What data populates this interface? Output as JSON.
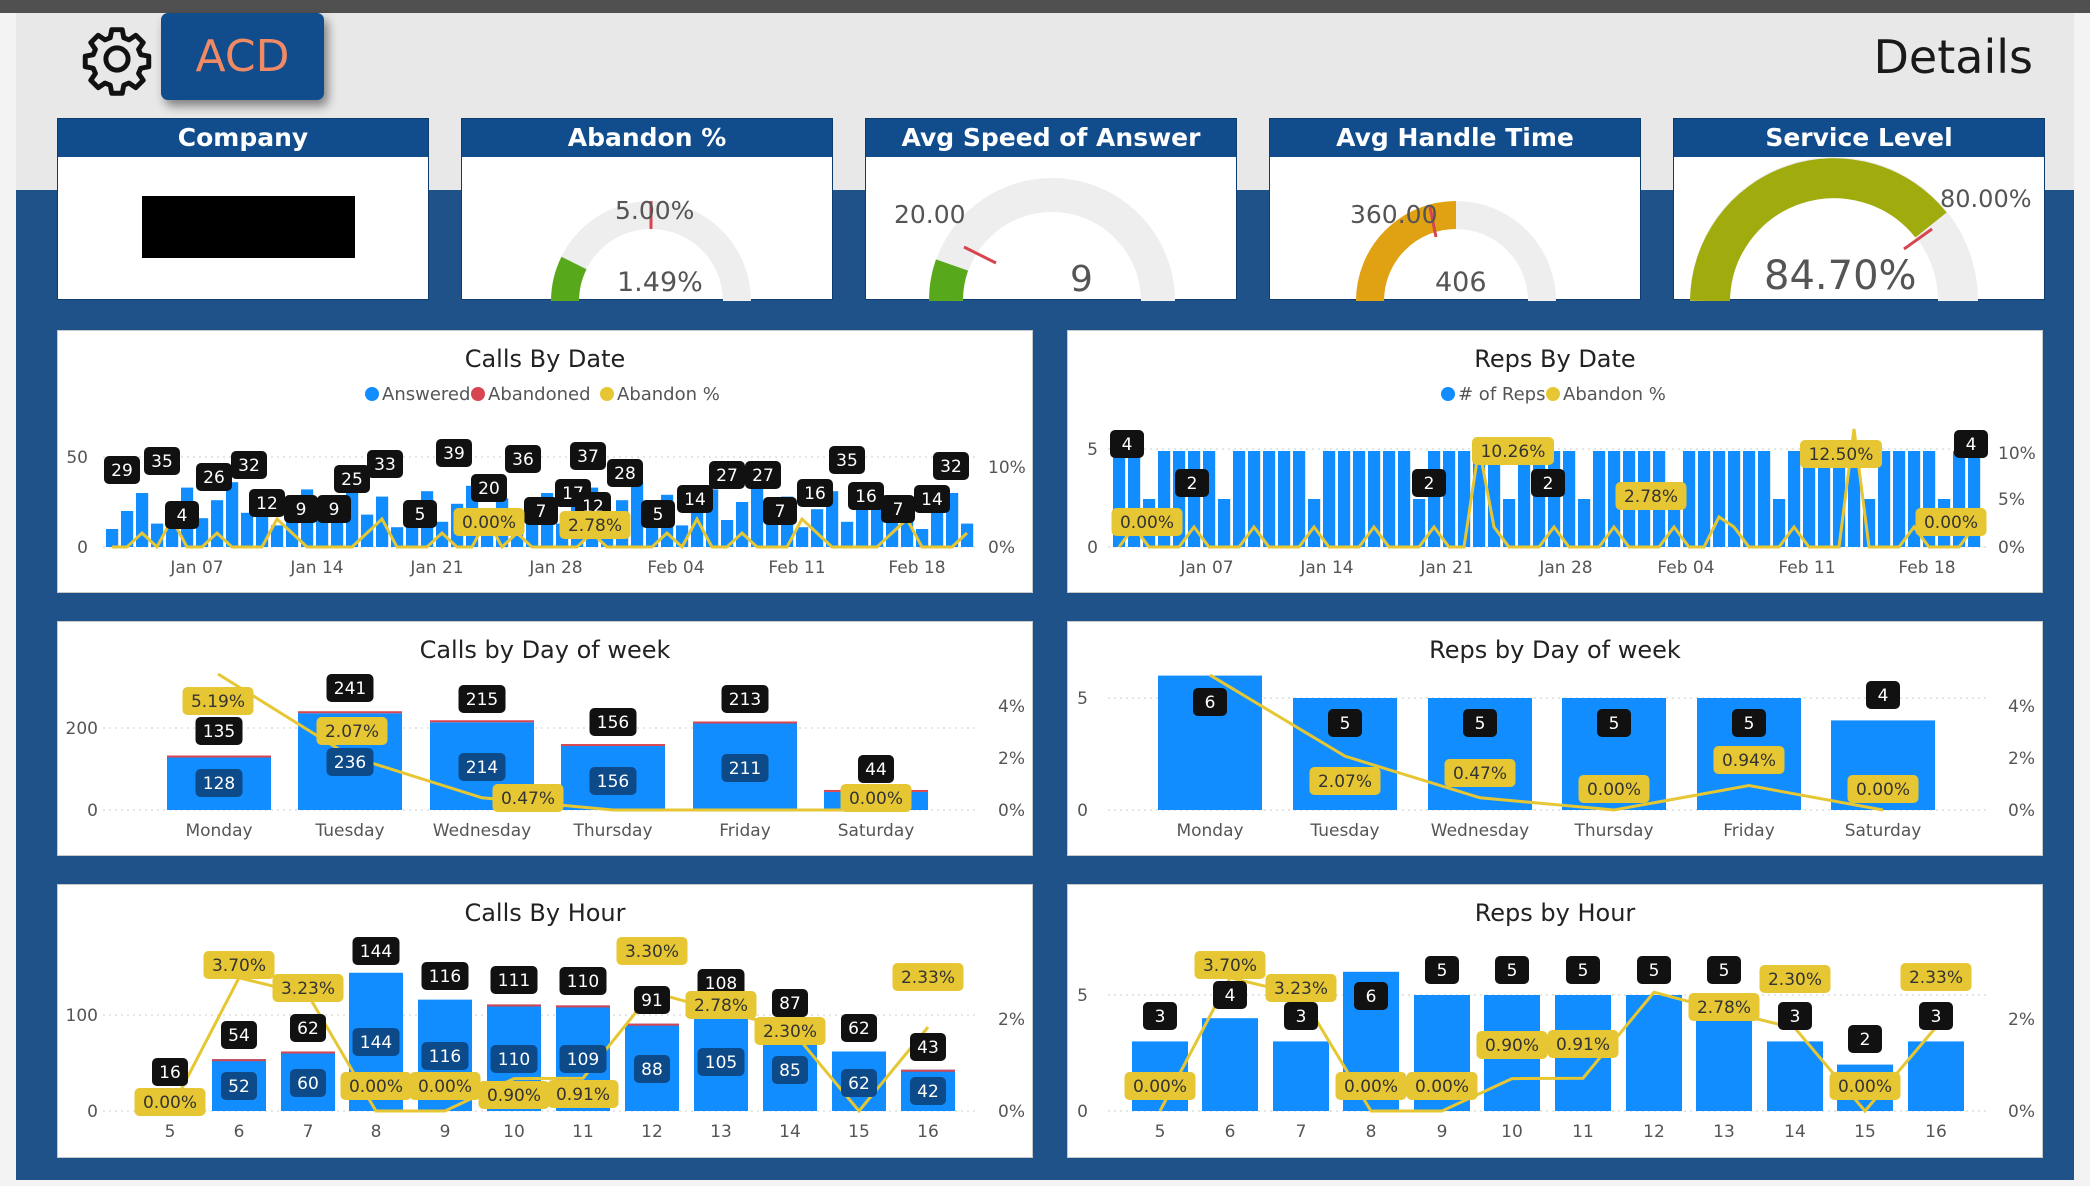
{
  "header": {
    "app_button": "ACD",
    "page_title": "Details",
    "settings_icon": "gear-icon"
  },
  "colors": {
    "navy": "#114c8c",
    "blue_bar": "#118dff",
    "red": "#d64550",
    "gold": "#e6c733",
    "gauge_green": "#57a81a",
    "gauge_orange": "#e0a112",
    "gauge_olive": "#a0ab0d",
    "label_dark": "#111111"
  },
  "kpis": {
    "company": {
      "title": "Company"
    },
    "abandon": {
      "title": "Abandon %",
      "target": "5.00%",
      "value": "1.49%",
      "fraction": 0.149
    },
    "asa": {
      "title": "Avg Speed of Answer",
      "target": "20.00",
      "value": "9",
      "fraction": 0.15
    },
    "aht": {
      "title": "Avg Handle Time",
      "target": "360.00",
      "value": "406",
      "fraction": 0.5
    },
    "service": {
      "title": "Service Level",
      "target": "80.00%",
      "value": "84.70%",
      "fraction": 0.8
    }
  },
  "charts": {
    "calls_by_date": {
      "title": "Calls By Date",
      "legend": [
        "Answered",
        "Abandoned",
        "Abandon %"
      ],
      "y_ticks": [
        "0",
        "50"
      ],
      "y2_ticks": [
        "0%",
        "10%"
      ],
      "x_ticks": [
        "Jan 07",
        "Jan 14",
        "Jan 21",
        "Jan 28",
        "Feb 04",
        "Feb 11",
        "Feb 18"
      ],
      "call_labels": [
        "29",
        "35",
        "4",
        "26",
        "32",
        "12",
        "9",
        "9",
        "25",
        "33",
        "5",
        "39",
        "20",
        "36",
        "7",
        "17",
        "12",
        "37",
        "28",
        "5",
        "14",
        "27",
        "27",
        "7",
        "16",
        "35",
        "16",
        "7",
        "14",
        "32"
      ],
      "pct_labels": [
        "0.00%",
        "2.78%"
      ]
    },
    "reps_by_date": {
      "title": "Reps By Date",
      "legend": [
        "# of Reps",
        "Abandon %"
      ],
      "y_ticks": [
        "0",
        "5"
      ],
      "y2_ticks": [
        "0%",
        "5%",
        "10%"
      ],
      "x_ticks": [
        "Jan 07",
        "Jan 14",
        "Jan 21",
        "Jan 28",
        "Feb 04",
        "Feb 11",
        "Feb 18"
      ],
      "rep_labels": [
        "4",
        "2",
        "2",
        "2",
        "4"
      ],
      "pct_labels": [
        "0.00%",
        "10.26%",
        "2.78%",
        "12.50%",
        "0.00%"
      ]
    },
    "calls_by_dow": {
      "title": "Calls by Day of week",
      "y_ticks": [
        "0",
        "200"
      ],
      "y2_ticks": [
        "0%",
        "2%",
        "4%"
      ],
      "categories": [
        "Monday",
        "Tuesday",
        "Wednesday",
        "Thursday",
        "Friday",
        "Saturday"
      ],
      "totals": [
        "135",
        "241",
        "215",
        "156",
        "213",
        "44"
      ],
      "answered": [
        "128",
        "236",
        "214",
        "156",
        "211",
        ""
      ],
      "abandon_pct": [
        "5.19%",
        "2.07%",
        "0.47%",
        "",
        "",
        "0.00%"
      ]
    },
    "reps_by_dow": {
      "title": "Reps by Day of week",
      "y_ticks": [
        "0",
        "5"
      ],
      "y2_ticks": [
        "0%",
        "2%",
        "4%"
      ],
      "categories": [
        "Monday",
        "Tuesday",
        "Wednesday",
        "Thursday",
        "Friday",
        "Saturday"
      ],
      "reps": [
        "6",
        "5",
        "5",
        "5",
        "5",
        "4"
      ],
      "abandon_pct": [
        "",
        "2.07%",
        "0.47%",
        "0.00%",
        "0.94%",
        "0.00%"
      ]
    },
    "calls_by_hour": {
      "title": "Calls By Hour",
      "y_ticks": [
        "0",
        "100"
      ],
      "y2_ticks": [
        "0%",
        "2%"
      ],
      "categories": [
        "5",
        "6",
        "7",
        "8",
        "9",
        "10",
        "11",
        "12",
        "13",
        "14",
        "15",
        "16"
      ],
      "totals": [
        "16",
        "54",
        "62",
        "144",
        "116",
        "111",
        "110",
        "91",
        "108",
        "87",
        "62",
        "43"
      ],
      "answered": [
        "",
        "52",
        "60",
        "144",
        "116",
        "110",
        "109",
        "88",
        "105",
        "85",
        "62",
        "42"
      ],
      "abandon_pct": [
        "0.00%",
        "3.70%",
        "3.23%",
        "0.00%",
        "0.00%",
        "0.90%",
        "0.91%",
        "3.30%",
        "2.78%",
        "2.30%",
        "",
        "2.33%"
      ]
    },
    "reps_by_hour": {
      "title": "Reps by Hour",
      "y_ticks": [
        "0",
        "5"
      ],
      "y2_ticks": [
        "0%",
        "2%"
      ],
      "categories": [
        "5",
        "6",
        "7",
        "8",
        "9",
        "10",
        "11",
        "12",
        "13",
        "14",
        "15",
        "16"
      ],
      "reps": [
        "3",
        "4",
        "3",
        "6",
        "5",
        "5",
        "5",
        "5",
        "5",
        "3",
        "2",
        "3"
      ],
      "abandon_pct": [
        "0.00%",
        "3.70%",
        "3.23%",
        "0.00%",
        "0.00%",
        "0.90%",
        "0.91%",
        "",
        "2.78%",
        "2.30%",
        "0.00%",
        "2.33%"
      ]
    }
  },
  "chart_data": [
    {
      "type": "bar",
      "title": "Calls by Day of week",
      "categories": [
        "Monday",
        "Tuesday",
        "Wednesday",
        "Thursday",
        "Friday",
        "Saturday"
      ],
      "series": [
        {
          "name": "Answered",
          "values": [
            128,
            236,
            214,
            156,
            211,
            44
          ]
        },
        {
          "name": "Abandon %",
          "values": [
            5.19,
            2.07,
            0.47,
            0.0,
            0.0,
            0.0
          ]
        }
      ]
    },
    {
      "type": "bar",
      "title": "Reps by Day of week",
      "categories": [
        "Monday",
        "Tuesday",
        "Wednesday",
        "Thursday",
        "Friday",
        "Saturday"
      ],
      "series": [
        {
          "values": [
            6,
            5,
            5,
            5,
            5,
            4
          ]
        },
        {
          "name": "Abandon %",
          "values": [
            5.19,
            2.07,
            0.47,
            0.0,
            0.94,
            0.0
          ]
        }
      ]
    },
    {
      "type": "bar",
      "title": "Calls By Hour",
      "categories": [
        "5",
        "6",
        "7",
        "8",
        "9",
        "10",
        "11",
        "12",
        "13",
        "14",
        "15",
        "16"
      ],
      "series": [
        {
          "name": "Answered",
          "values": [
            16,
            52,
            60,
            144,
            116,
            110,
            109,
            88,
            105,
            85,
            62,
            42
          ]
        },
        {
          "name": "Abandon %",
          "values": [
            0.0,
            3.7,
            3.23,
            0.0,
            0.0,
            0.9,
            0.91,
            3.3,
            2.78,
            2.3,
            0.0,
            2.33
          ]
        }
      ]
    },
    {
      "type": "bar",
      "title": "Reps by Hour",
      "categories": [
        "5",
        "6",
        "7",
        "8",
        "9",
        "10",
        "11",
        "12",
        "13",
        "14",
        "15",
        "16"
      ],
      "series": [
        {
          "values": [
            3,
            4,
            3,
            6,
            5,
            5,
            5,
            5,
            5,
            3,
            2,
            3
          ]
        },
        {
          "name": "Abandon %",
          "values": [
            0.0,
            3.7,
            3.23,
            0.0,
            0.0,
            0.9,
            0.91,
            3.3,
            2.78,
            2.3,
            0.0,
            2.33
          ]
        }
      ]
    }
  ]
}
